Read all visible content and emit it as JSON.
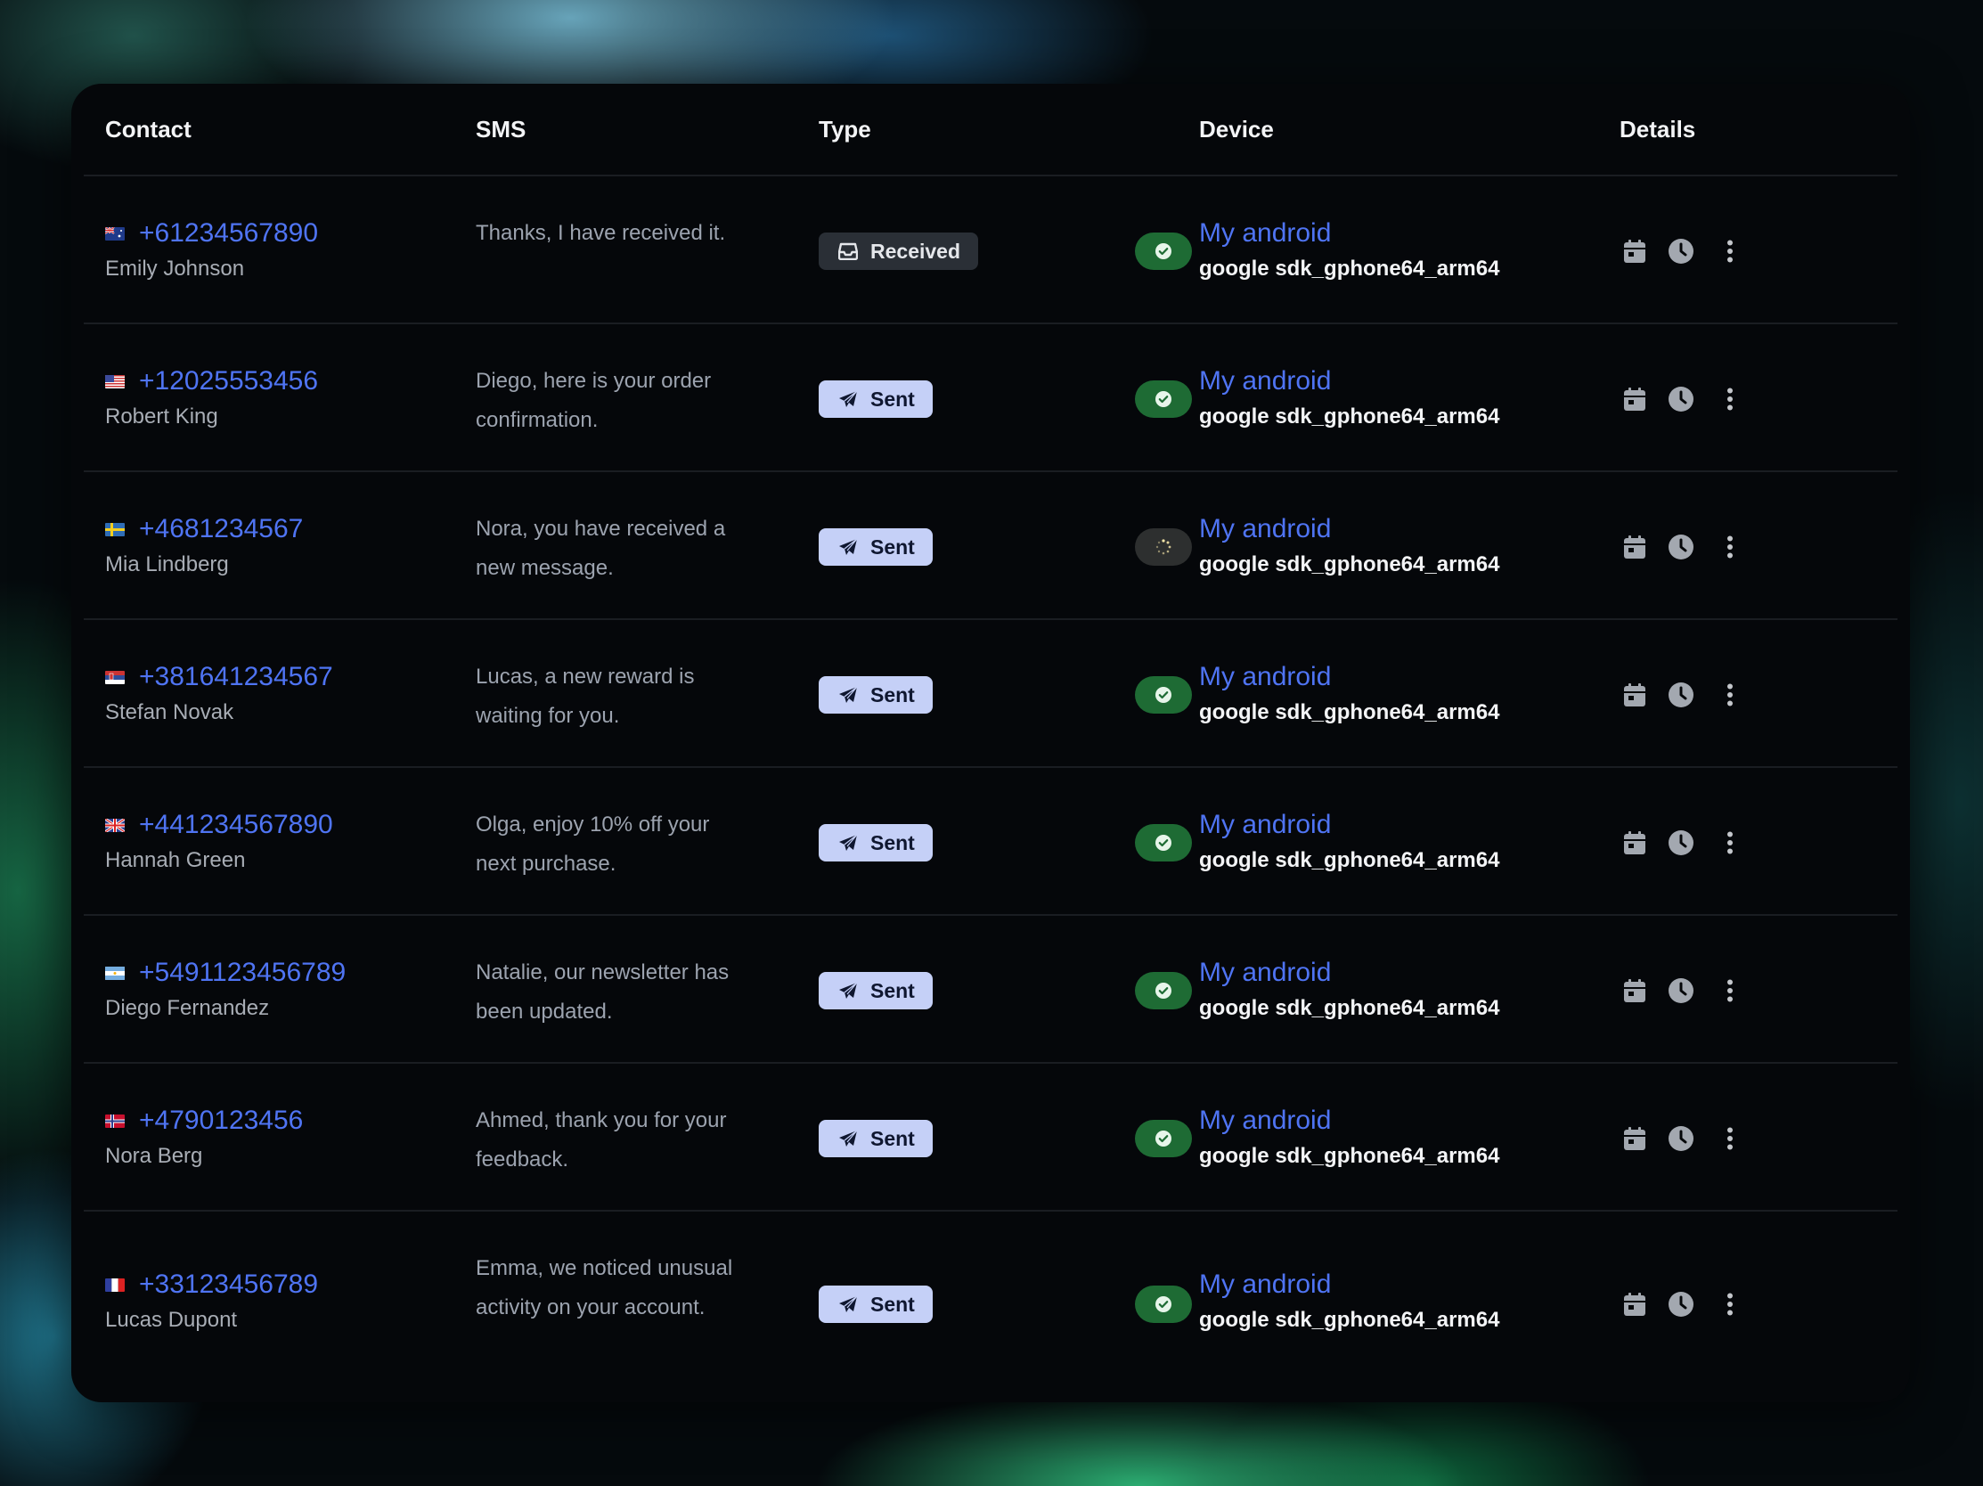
{
  "table": {
    "columns": {
      "contact": "Contact",
      "sms": "SMS",
      "type": "Type",
      "device": "Device",
      "details": "Details"
    },
    "rows": [
      {
        "flag": "au-flag-icon",
        "phone": "+61234567890",
        "name": "Emily Johnson",
        "sms": "Thanks, I have received it.",
        "type": "Received",
        "type_icon": "inbox-icon",
        "status": "delivered",
        "device_name": "My android",
        "device_model": "google sdk_gphone64_arm64"
      },
      {
        "flag": "us-flag-icon",
        "phone": "+12025553456",
        "name": "Robert King",
        "sms": "Diego, here is your order confirmation.",
        "type": "Sent",
        "type_icon": "paper-plane-icon",
        "status": "delivered",
        "device_name": "My android",
        "device_model": "google sdk_gphone64_arm64"
      },
      {
        "flag": "se-flag-icon",
        "phone": "+4681234567",
        "name": "Mia Lindberg",
        "sms": "Nora, you have received a new message.",
        "type": "Sent",
        "type_icon": "paper-plane-icon",
        "status": "pending",
        "device_name": "My android",
        "device_model": "google sdk_gphone64_arm64"
      },
      {
        "flag": "rs-flag-icon",
        "phone": "+381641234567",
        "name": "Stefan Novak",
        "sms": "Lucas, a new reward is waiting for you.",
        "type": "Sent",
        "type_icon": "paper-plane-icon",
        "status": "delivered",
        "device_name": "My android",
        "device_model": "google sdk_gphone64_arm64"
      },
      {
        "flag": "gb-flag-icon",
        "phone": "+441234567890",
        "name": "Hannah Green",
        "sms": "Olga, enjoy 10% off your next purchase.",
        "type": "Sent",
        "type_icon": "paper-plane-icon",
        "status": "delivered",
        "device_name": "My android",
        "device_model": "google sdk_gphone64_arm64"
      },
      {
        "flag": "ar-flag-icon",
        "phone": "+5491123456789",
        "name": "Diego Fernandez",
        "sms": "Natalie, our newsletter has been updated.",
        "type": "Sent",
        "type_icon": "paper-plane-icon",
        "status": "delivered",
        "device_name": "My android",
        "device_model": "google sdk_gphone64_arm64"
      },
      {
        "flag": "no-flag-icon",
        "phone": "+4790123456",
        "name": "Nora Berg",
        "sms": "Ahmed, thank you for your feedback.",
        "type": "Sent",
        "type_icon": "paper-plane-icon",
        "status": "delivered",
        "device_name": "My android",
        "device_model": "google sdk_gphone64_arm64"
      },
      {
        "flag": "fr-flag-icon",
        "phone": "+33123456789",
        "name": "Lucas Dupont",
        "sms": "Emma, we noticed unusual activity on your account.",
        "type": "Sent",
        "type_icon": "paper-plane-icon",
        "status": "delivered",
        "device_name": "My android",
        "device_model": "google sdk_gphone64_arm64"
      }
    ]
  },
  "icons": {
    "details_calendar": "calendar-icon",
    "details_clock": "clock-icon",
    "row_menu": "more-vertical-icon",
    "status_ok": "check-circle-icon",
    "status_pending": "spinner-icon"
  },
  "colors": {
    "link": "#4f74f3",
    "sent_badge": "#c5d0f7",
    "received_badge": "#2a2f36",
    "status_ok": "#1e6b34",
    "status_pending": "#2d2f2f",
    "card_bg": "#05070a"
  }
}
